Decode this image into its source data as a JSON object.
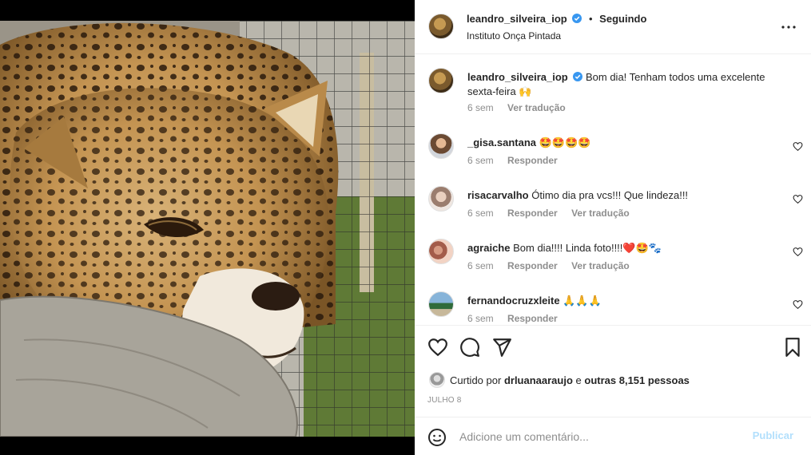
{
  "post": {
    "username": "leandro_silveira_iop",
    "follow_status": "Seguindo",
    "location": "Instituto Onça Pintada",
    "caption": "Bom dia! Tenham todos uma excelente sexta-feira 🙌",
    "caption_time": "6 sem",
    "caption_translate": "Ver tradução"
  },
  "comments": [
    {
      "username": "_gisa.santana",
      "text": "🤩🤩🤩🤩",
      "time": "6 sem",
      "reply": "Responder",
      "translate": ""
    },
    {
      "username": "risacarvalho",
      "text": "Ótimo dia pra vcs!!! Que lindeza!!!",
      "time": "6 sem",
      "reply": "Responder",
      "translate": "Ver tradução"
    },
    {
      "username": "agraiche",
      "text": "Bom dia!!!! Linda foto!!!!❤️🤩🐾",
      "time": "6 sem",
      "reply": "Responder",
      "translate": "Ver tradução"
    },
    {
      "username": "fernandocruzxleite",
      "text": "🙏🙏🙏",
      "time": "6 sem",
      "reply": "Responder",
      "translate": ""
    }
  ],
  "likes": {
    "prefix": "Curtido por",
    "liker": "drluanaaraujo",
    "conj": "e",
    "others": "outras 8,151 pessoas"
  },
  "date": "JULHO 8",
  "add_comment": {
    "placeholder": "Adicione um comentário...",
    "publish_label": "Publicar"
  },
  "colors": {
    "verified": "#3897f0",
    "secondary_text": "#8e8e8e",
    "publish_disabled": "#b2dffc"
  },
  "icons": {
    "more": "more-options-icon",
    "like": "heart-icon",
    "comment": "comment-icon",
    "share": "send-icon",
    "save": "bookmark-icon",
    "emoji": "emoji-icon"
  }
}
